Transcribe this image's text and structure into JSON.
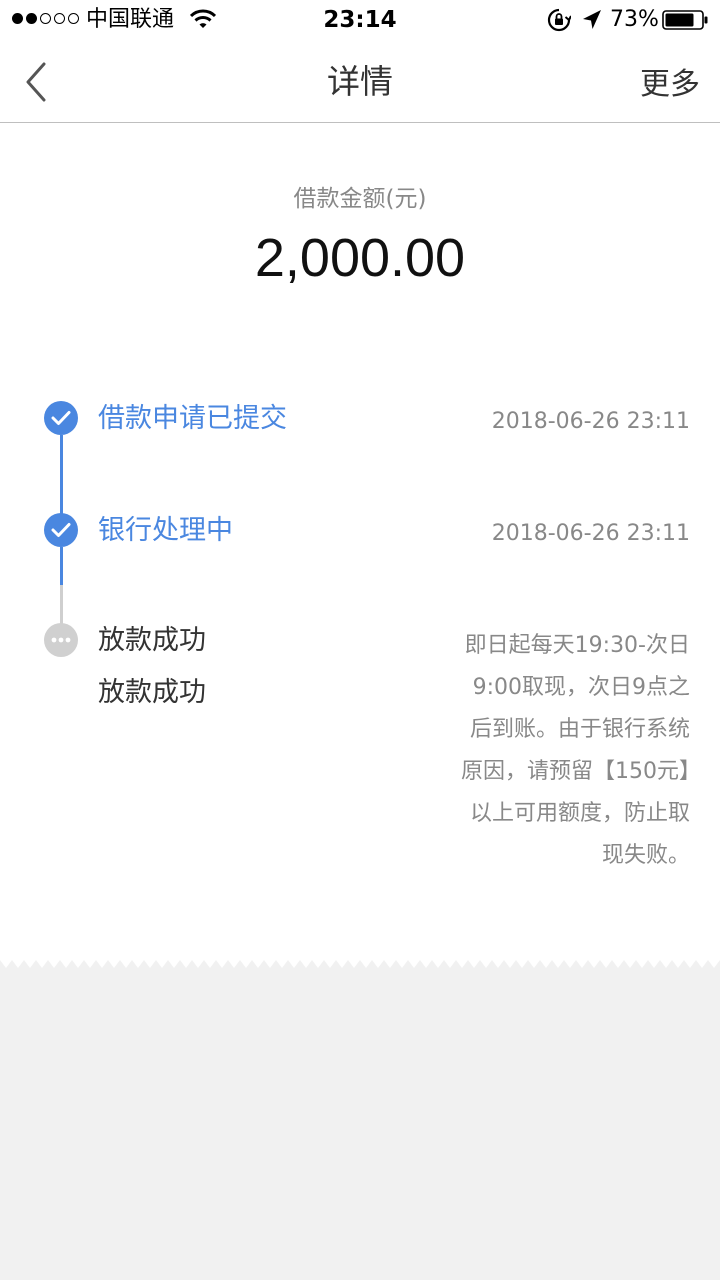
{
  "status_bar": {
    "carrier": "中国联通",
    "time": "23:14",
    "battery_percent": "73%",
    "signal_full_dots": 2,
    "signal_total_dots": 5
  },
  "nav": {
    "title": "详情",
    "more_label": "更多",
    "back_icon": "chevron-left-icon"
  },
  "loan": {
    "amount_label": "借款金额(元)",
    "amount": "2,000.00"
  },
  "steps": [
    {
      "title": "借款申请已提交",
      "time": "2018-06-26 23:11",
      "status": "done"
    },
    {
      "title": "银行处理中",
      "time": "2018-06-26 23:11",
      "status": "done"
    },
    {
      "title": "放款成功",
      "subtitle": "放款成功",
      "note": "即日起每天19:30-次日9:00取现，次日9点之后到账。由于银行系统原因，请预留【150元】以上可用额度，防止取现失败。",
      "status": "pending"
    }
  ],
  "colors": {
    "accent": "#4a87e0",
    "pending": "#d0d0d0",
    "background": "#f1f1f1"
  }
}
